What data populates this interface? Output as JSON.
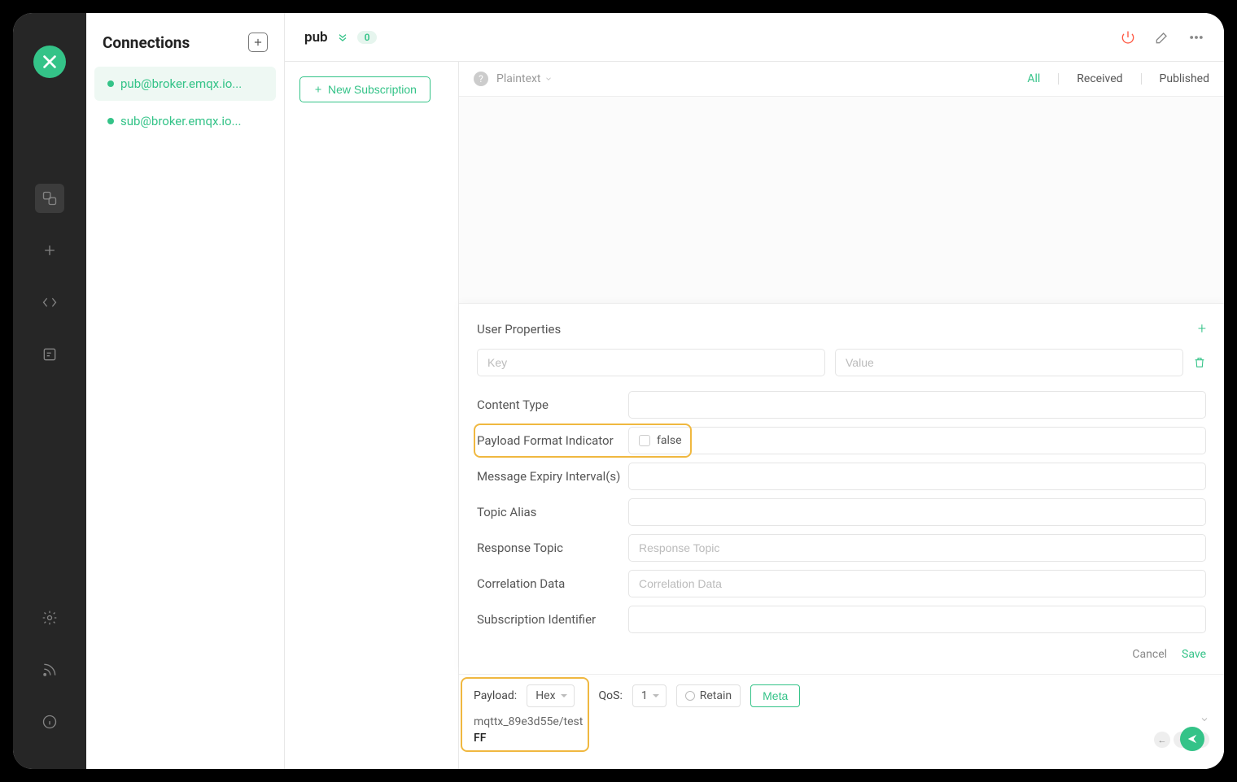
{
  "sidebar_title": "Connections",
  "connections": [
    {
      "name": "pub@broker.emqx.io...",
      "active": true
    },
    {
      "name": "sub@broker.emqx.io...",
      "active": false
    }
  ],
  "main": {
    "title": "pub",
    "badge": "0",
    "new_subscription": "New Subscription",
    "format": "Plaintext",
    "filters": {
      "all": "All",
      "received": "Received",
      "published": "Published"
    }
  },
  "meta": {
    "user_properties_title": "User Properties",
    "key_placeholder": "Key",
    "value_placeholder": "Value",
    "content_type_label": "Content Type",
    "pfi_label": "Payload Format Indicator",
    "pfi_value": "false",
    "mei_label": "Message Expiry Interval(s)",
    "topic_alias_label": "Topic Alias",
    "response_topic_label": "Response Topic",
    "response_topic_placeholder": "Response Topic",
    "correlation_data_label": "Correlation Data",
    "correlation_data_placeholder": "Correlation Data",
    "sub_id_label": "Subscription Identifier",
    "cancel": "Cancel",
    "save": "Save"
  },
  "publish": {
    "payload_label": "Payload:",
    "payload_format": "Hex",
    "qos_label": "QoS:",
    "qos_value": "1",
    "retain_label": "Retain",
    "meta_btn": "Meta",
    "topic": "mqttx_89e3d55e/test",
    "payload": "FF"
  }
}
